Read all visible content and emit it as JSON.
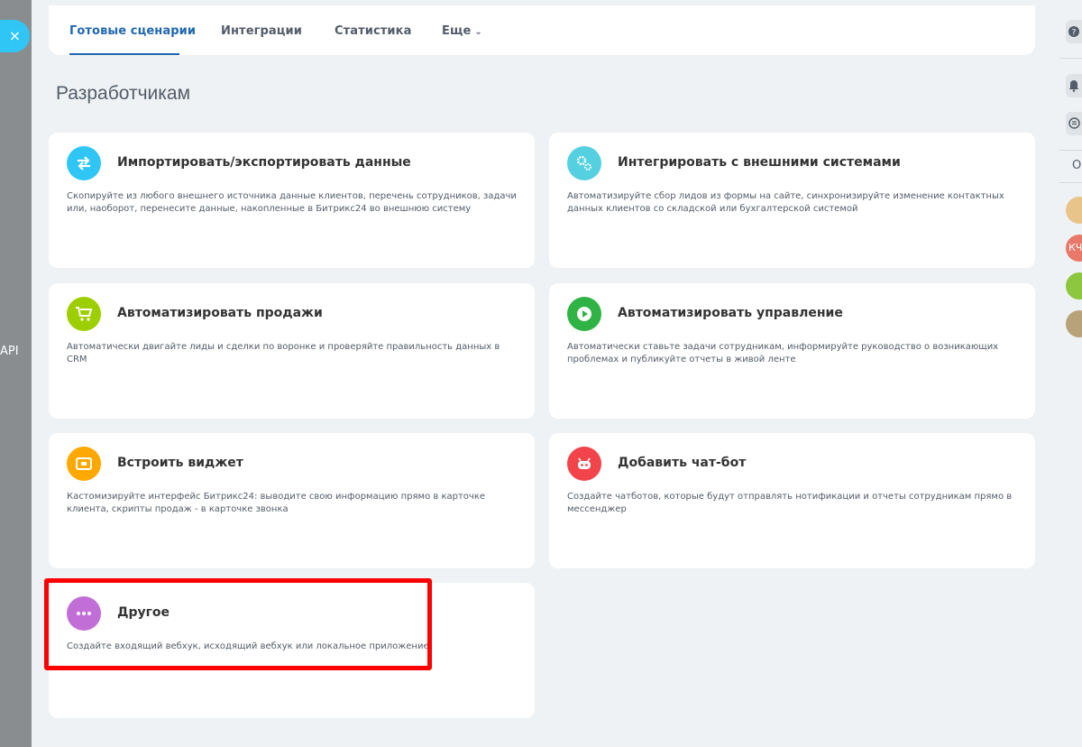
{
  "left_panel": {
    "close_label": "×",
    "api_label": "API"
  },
  "tabs": [
    {
      "label": "Готовые сценарии"
    },
    {
      "label": "Интеграции"
    },
    {
      "label": "Статистика"
    },
    {
      "label": "Еще"
    }
  ],
  "tab_more_chevron": "⌄",
  "page_title": "Разработчикам",
  "cards": [
    {
      "title": "Импортировать/экспортировать данные",
      "desc": "Скопируйте из любого внешнего источника данные клиентов, перечень сотрудников, задачи или, наоборот, перенесите данные, накопленные в Битрикс24 во внешнюю систему",
      "icon": "arrows-swap-icon",
      "color": "#2fc6f6"
    },
    {
      "title": "Интегрировать с внешними системами",
      "desc": "Автоматизируйте сбор лидов из формы на сайте, синхронизируйте изменение контактных данных клиентов со складской или бухгалтерской системой",
      "icon": "gears-icon",
      "color": "#55d0e0"
    },
    {
      "title": "Автоматизировать продажи",
      "desc": "Автоматически двигайте лиды и сделки по воронке и проверяйте правильность данных в CRM",
      "icon": "cart-icon",
      "color": "#9dcf00"
    },
    {
      "title": "Автоматизировать управление",
      "desc": "Автоматически ставьте задачи сотрудникам, информируйте руководство о возникающих проблемах и публикуйте отчеты в живой ленте",
      "icon": "play-icon",
      "color": "#2fb344"
    },
    {
      "title": "Встроить виджет",
      "desc": "Кастомизируйте интерфейс Битрикс24: выводите свою информацию прямо в карточке клиента, скрипты продаж - в карточке звонка",
      "icon": "widget-icon",
      "color": "#ffa900"
    },
    {
      "title": "Добавить чат-бот",
      "desc": "Создайте чатботов, которые будут отправлять нотификации и отчеты сотрудникам прямо в мессенджер",
      "icon": "robot-icon",
      "color": "#f2454b"
    },
    {
      "title": "Другое",
      "desc": "Создайте входящий вебхук, исходящий вебхук или локальное приложение",
      "icon": "dots-icon",
      "color": "#c16ed6"
    }
  ],
  "right_rail": {
    "search_letter": "О",
    "avatar_initials": "КЧ"
  },
  "colors": {
    "accent": "#2067b0",
    "highlight": "#ff0000"
  }
}
